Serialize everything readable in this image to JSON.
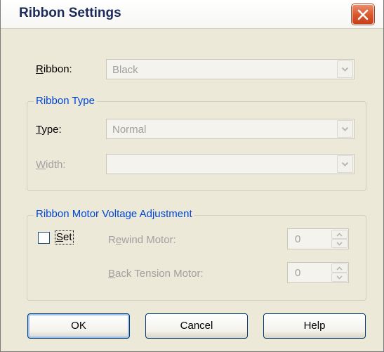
{
  "dialog": {
    "title": "Ribbon Settings"
  },
  "ribbon": {
    "label_mnemonic": "R",
    "label_rest": "ibbon:",
    "value": "Black"
  },
  "ribbon_type_group": {
    "title": "Ribbon Type",
    "type_label_mnemonic": "T",
    "type_label_rest": "ype:",
    "type_value": "Normal",
    "width_label_mnemonic": "W",
    "width_label_rest": "idth:",
    "width_value": ""
  },
  "motor_group": {
    "title": "Ribbon Motor Voltage Adjustment",
    "set_checkbox": {
      "label_mnemonic": "S",
      "label_rest": "et",
      "checked": false
    },
    "rewind_label_start": "R",
    "rewind_label_mnemonic": "e",
    "rewind_label_rest": "wind Motor:",
    "rewind_value": "0",
    "back_tension_label_mnemonic": "B",
    "back_tension_label_rest": "ack Tension Motor:",
    "back_tension_value": "0"
  },
  "buttons": {
    "ok": "OK",
    "cancel": "Cancel",
    "help": "Help"
  },
  "icons": {
    "close": "close-icon",
    "dropdown": "chevron-down-icon",
    "spin_up": "spin-up-icon",
    "spin_down": "spin-down-icon"
  },
  "colors": {
    "dialog_bg": "#ece9d8",
    "group_title": "#0046d5",
    "disabled_text": "#a0a0a0",
    "close_button": "#d8552c"
  }
}
